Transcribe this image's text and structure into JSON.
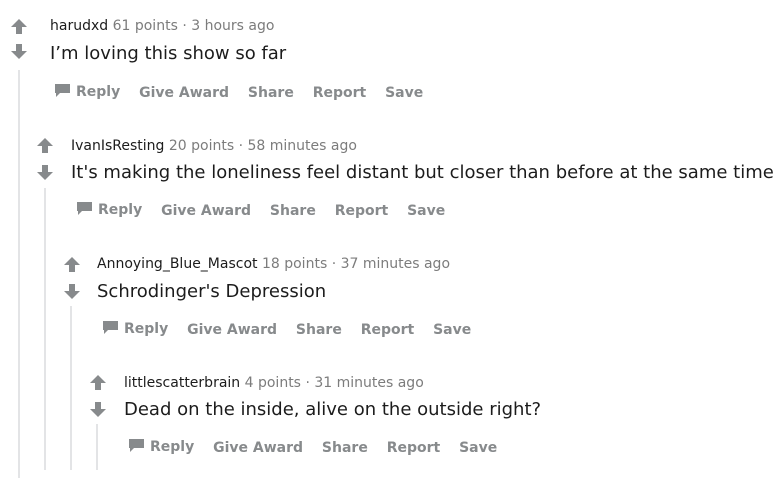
{
  "comments": [
    {
      "author": "harudxd",
      "points": "61 points",
      "separator": "·",
      "time": "3 hours ago",
      "text": "I’m loving this show so far",
      "actions": {
        "reply": "Reply",
        "award": "Give Award",
        "share": "Share",
        "report": "Report",
        "save": "Save"
      }
    },
    {
      "author": "IvanIsResting",
      "points": "20 points",
      "separator": "·",
      "time": "58 minutes ago",
      "text": "It's making the loneliness feel distant but closer than before at the same time",
      "actions": {
        "reply": "Reply",
        "award": "Give Award",
        "share": "Share",
        "report": "Report",
        "save": "Save"
      }
    },
    {
      "author": "Annoying_Blue_Mascot",
      "points": "18 points",
      "separator": "·",
      "time": "37 minutes ago",
      "text": "Schrodinger's Depression",
      "actions": {
        "reply": "Reply",
        "award": "Give Award",
        "share": "Share",
        "report": "Report",
        "save": "Save"
      }
    },
    {
      "author": "littlescatterbrain",
      "points": "4 points",
      "separator": "·",
      "time": "31 minutes ago",
      "text": "Dead on the inside, alive on the outside right?",
      "actions": {
        "reply": "Reply",
        "award": "Give Award",
        "share": "Share",
        "report": "Report",
        "save": "Save"
      }
    }
  ],
  "colors": {
    "vote_arrow": "#878a8c",
    "thread_line": "#e3e4e6",
    "action_text": "#878a8c",
    "meta_text": "#7c7c7c"
  }
}
